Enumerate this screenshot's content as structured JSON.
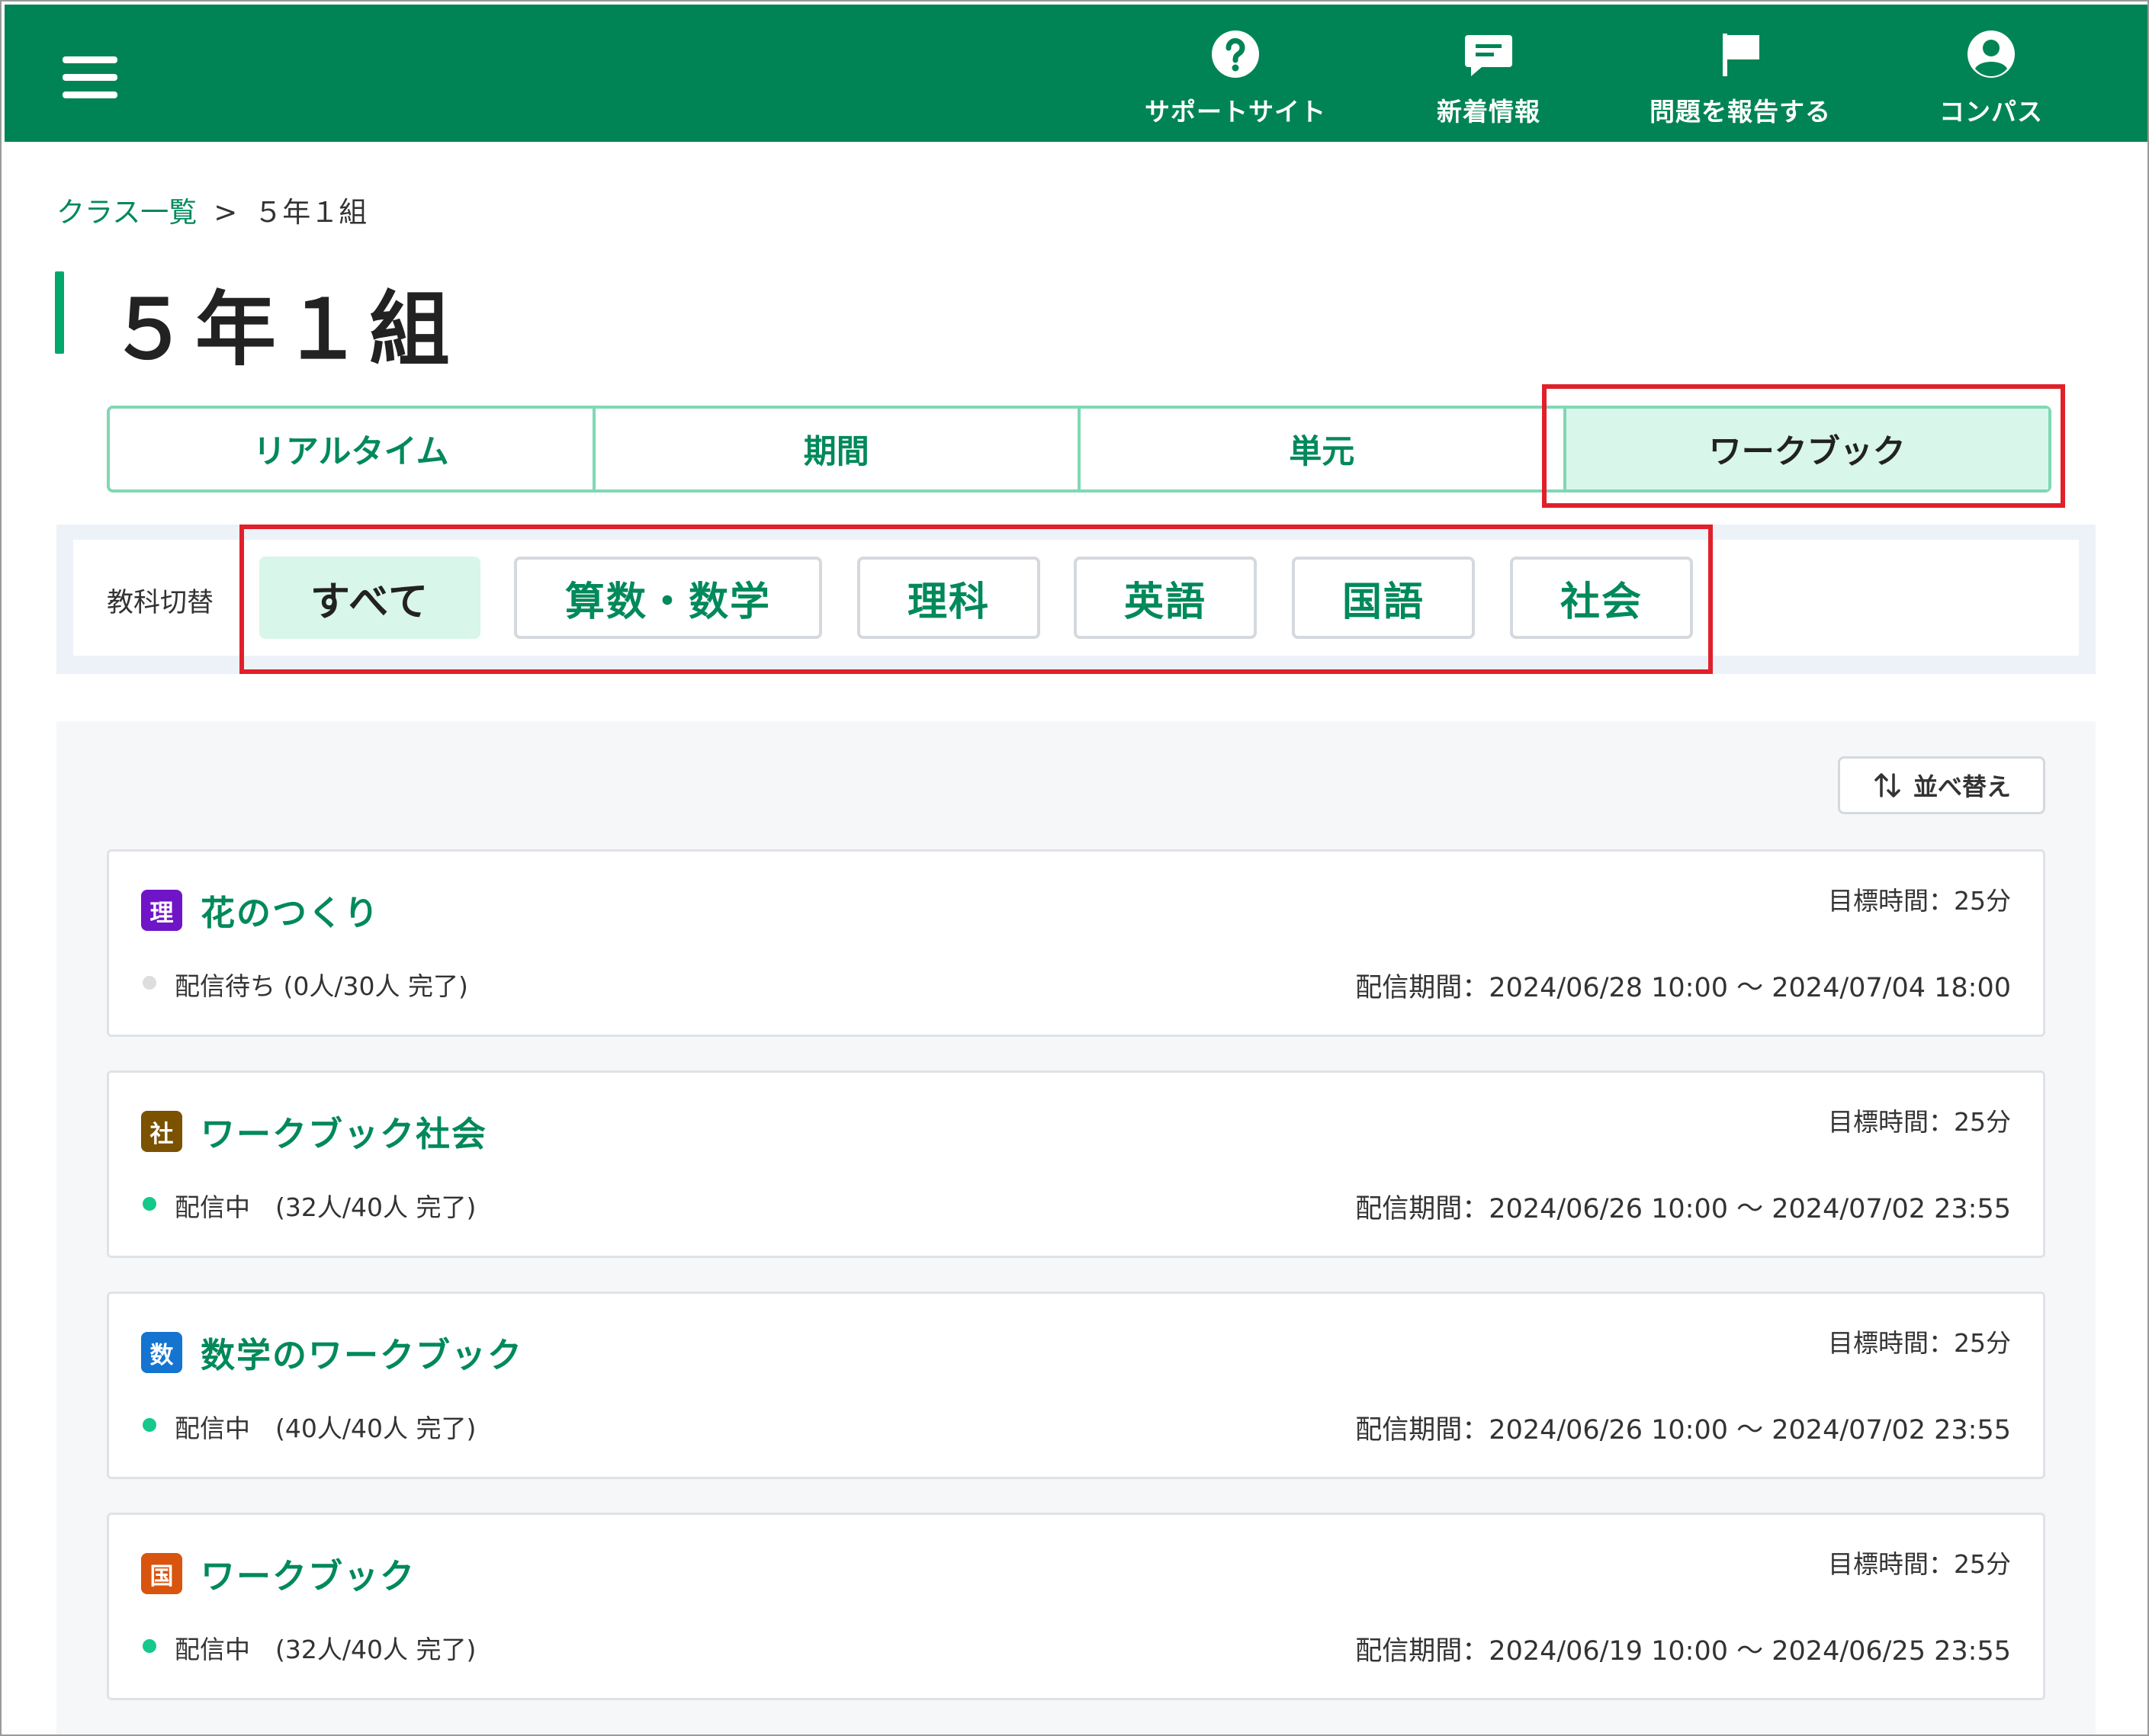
{
  "header": {
    "nav": [
      {
        "label": "サポートサイト",
        "icon": "help-circle-icon"
      },
      {
        "label": "新着情報",
        "icon": "message-icon"
      },
      {
        "label": "問題を報告する",
        "icon": "flag-icon"
      },
      {
        "label": "コンパス",
        "icon": "user-circle-icon"
      }
    ]
  },
  "breadcrumb": {
    "parent": "クラス一覧",
    "separator": ">",
    "current": "５年１組"
  },
  "page": {
    "title": "５年１組"
  },
  "tabs": [
    {
      "label": "リアルタイム"
    },
    {
      "label": "期間"
    },
    {
      "label": "単元"
    },
    {
      "label": "ワークブック"
    }
  ],
  "subject_filter": {
    "label": "教科切替",
    "options": [
      {
        "label": "すべて"
      },
      {
        "label": "算数・数学"
      },
      {
        "label": "理科"
      },
      {
        "label": "英語"
      },
      {
        "label": "国語"
      },
      {
        "label": "社会"
      }
    ]
  },
  "sort": {
    "label": "並べ替え"
  },
  "colors": {
    "brand": "#008455",
    "accent": "#00895a",
    "active_tab_bg": "#d8f6e9",
    "highlight": "#e0202a",
    "status_active": "#14c98a",
    "status_waiting": "#dddddd"
  },
  "workbooks": [
    {
      "subject_badge": "理",
      "badge_color": "#7014c8",
      "title": "花のつくり",
      "goal": "目標時間：25分",
      "status": "配信待ち (0人/30人 完了)",
      "status_color": "#dddddd",
      "period": "配信期間：2024/06/28 10:00 〜 2024/07/04 18:00"
    },
    {
      "subject_badge": "社",
      "badge_color": "#7a5200",
      "title": "ワークブック社会",
      "goal": "目標時間：25分",
      "status": "配信中　(32人/40人 完了)",
      "status_color": "#14c98a",
      "period": "配信期間：2024/06/26 10:00 〜 2024/07/02 23:55"
    },
    {
      "subject_badge": "数",
      "badge_color": "#1474d0",
      "title": "数学のワークブック",
      "goal": "目標時間：25分",
      "status": "配信中　(40人/40人 完了)",
      "status_color": "#14c98a",
      "period": "配信期間：2024/06/26 10:00 〜 2024/07/02 23:55"
    },
    {
      "subject_badge": "国",
      "badge_color": "#d9540e",
      "title": "ワークブック",
      "goal": "目標時間：25分",
      "status": "配信中　(32人/40人 完了)",
      "status_color": "#14c98a",
      "period": "配信期間：2024/06/19 10:00 〜 2024/06/25 23:55"
    }
  ]
}
